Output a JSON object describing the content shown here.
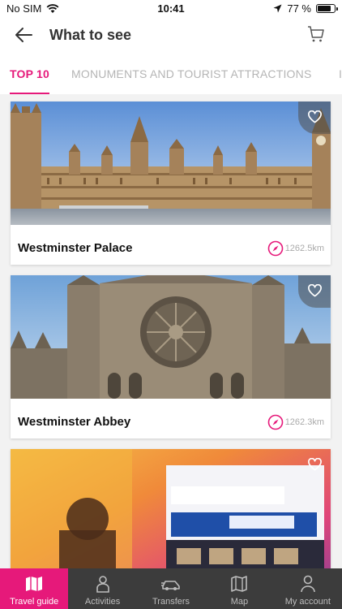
{
  "status_bar": {
    "carrier": "No SIM",
    "time": "10:41",
    "battery": "77 %",
    "battery_level": 0.77
  },
  "header": {
    "title": "What to see"
  },
  "tabs": [
    {
      "label": "TOP 10",
      "active": true
    },
    {
      "label": "MONUMENTS AND TOURIST ATTRACTIONS",
      "active": false
    }
  ],
  "places": [
    {
      "name": "Westminster Palace",
      "distance": "1262.5km"
    },
    {
      "name": "Westminster Abbey",
      "distance": "1262.3km"
    },
    {
      "name": "",
      "distance": ""
    }
  ],
  "bottom_nav": [
    {
      "label": "Travel guide",
      "icon": "map-book-icon",
      "active": true
    },
    {
      "label": "Activities",
      "icon": "person-icon",
      "active": false
    },
    {
      "label": "Transfers",
      "icon": "car-icon",
      "active": false
    },
    {
      "label": "Map",
      "icon": "map-icon",
      "active": false
    },
    {
      "label": "My account",
      "icon": "user-icon",
      "active": false
    }
  ],
  "colors": {
    "accent": "#e6197a",
    "nav_bg": "#3c3c3c"
  }
}
